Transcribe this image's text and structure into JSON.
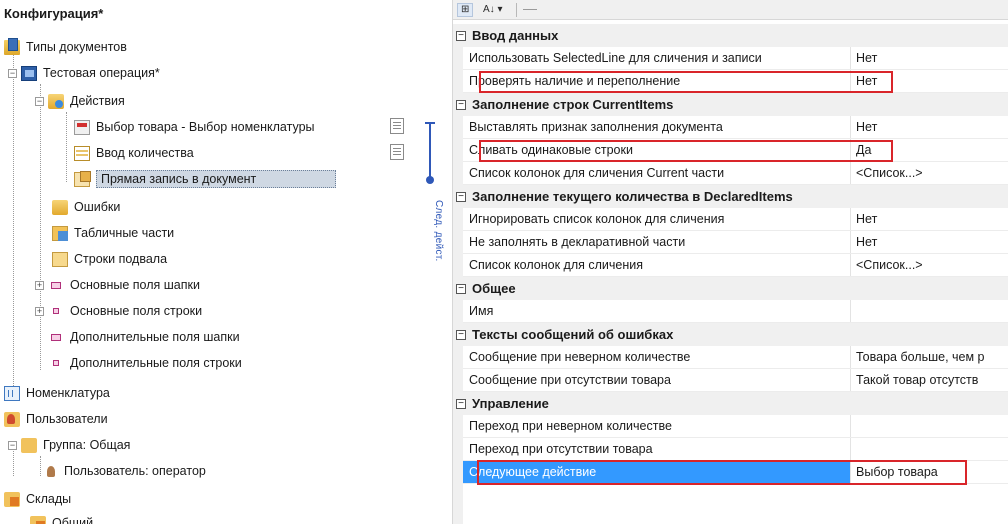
{
  "tree": {
    "title": "Конфигурация*",
    "items": [
      {
        "label": "Типы документов"
      },
      {
        "label": "Тестовая операция*"
      },
      {
        "label": "Действия"
      },
      {
        "label": "Выбор товара - Выбор номенклатуры"
      },
      {
        "label": "Ввод количества"
      },
      {
        "label": "Прямая запись в документ"
      },
      {
        "label": "Ошибки"
      },
      {
        "label": "Табличные части"
      },
      {
        "label": "Строки подвала"
      },
      {
        "label": "Основные поля шапки"
      },
      {
        "label": "Основные поля строки"
      },
      {
        "label": "Дополнительные поля шапки"
      },
      {
        "label": "Дополнительные поля строки"
      },
      {
        "label": "Номенклатура"
      },
      {
        "label": "Пользователи"
      },
      {
        "label": "Группа: Общая"
      },
      {
        "label": "Пользователь: оператор"
      },
      {
        "label": "Склады"
      },
      {
        "label": "Общий"
      }
    ],
    "connector_caption": "След. дейст."
  },
  "toolbar": {
    "sort_categorized": "⊞",
    "sort_alpha": "A↓ ▾"
  },
  "properties": {
    "categories": [
      {
        "label": "Ввод данных"
      },
      {
        "label": "Заполнение строк CurrentItems"
      },
      {
        "label": "Заполнение текущего количества в DeclaredItems"
      },
      {
        "label": "Общее"
      },
      {
        "label": "Тексты сообщений об ошибках"
      },
      {
        "label": "Управление"
      }
    ],
    "rows": [
      {
        "name": "Использовать SelectedLine для сличения и записи",
        "value": "Нет"
      },
      {
        "name": "Проверять наличие и переполнение",
        "value": "Нет"
      },
      {
        "name": "Выставлять признак заполнения документа",
        "value": "Нет"
      },
      {
        "name": "Сливать одинаковые строки",
        "value": "Да"
      },
      {
        "name": "Список колонок для сличения Current части",
        "value": "<Список...>"
      },
      {
        "name": "Игнорировать список колонок для сличения",
        "value": "Нет"
      },
      {
        "name": "Не заполнять в декларативной части",
        "value": "Нет"
      },
      {
        "name": "Список колонок для сличения",
        "value": "<Список...>"
      },
      {
        "name": "Имя",
        "value": ""
      },
      {
        "name": "Сообщение при неверном количестве",
        "value": "Товара больше, чем р"
      },
      {
        "name": "Сообщение при отсутствии товара",
        "value": "Такой товар отсутств"
      },
      {
        "name": "Переход при неверном количестве",
        "value": ""
      },
      {
        "name": "Переход при отсутствии товара",
        "value": ""
      },
      {
        "name": "Следующее действие",
        "value": "Выбор товара"
      }
    ]
  },
  "colors": {
    "selection": "#3399ff",
    "highlight": "#d9252a",
    "connector": "#2f58b8"
  }
}
